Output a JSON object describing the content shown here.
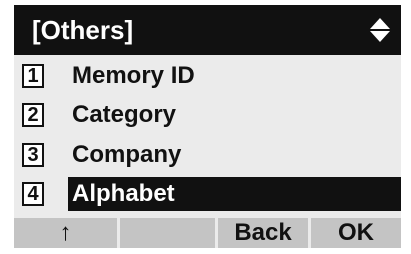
{
  "header": {
    "title": "[Others]",
    "nav_icon": "up-down-arrow-icon"
  },
  "menu": {
    "items": [
      {
        "number": "1",
        "label": "Memory ID",
        "selected": false
      },
      {
        "number": "2",
        "label": "Category",
        "selected": false
      },
      {
        "number": "3",
        "label": "Company",
        "selected": false
      },
      {
        "number": "4",
        "label": "Alphabet",
        "selected": true
      }
    ]
  },
  "softkeys": [
    {
      "label": "↑"
    },
    {
      "label": ""
    },
    {
      "label": "Back"
    },
    {
      "label": "OK"
    }
  ],
  "colors": {
    "title_bg": "#111111",
    "screen_bg": "#ebebeb",
    "softkey_bg": "#c4c4c4",
    "selected_bg": "#111111"
  }
}
